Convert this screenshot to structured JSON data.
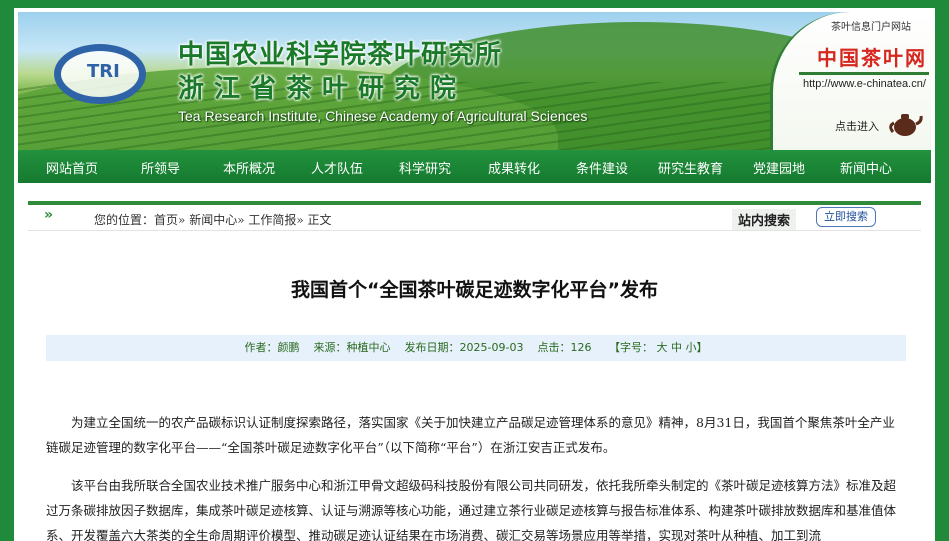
{
  "banner": {
    "logo_text": "TRI",
    "title_cn_1": "中国农业科学院茶叶研究所",
    "title_cn_2": "浙江省茶叶研究院",
    "title_en": "Tea Research Institute, Chinese Academy of Agricultural Sciences",
    "side_caption": "茶叶信息门户网站",
    "side_brand": "中国茶叶网",
    "side_url": "http://www.e-chinatea.cn/",
    "side_enter": "点击进入"
  },
  "nav": {
    "items": [
      "网站首页",
      "所领导",
      "本所概况",
      "人才队伍",
      "科学研究",
      "成果转化",
      "条件建设",
      "研究生教育",
      "党建园地",
      "新闻中心"
    ]
  },
  "breadcrumb": {
    "arrow": "»",
    "prefix": "您的位置：",
    "home": "首页",
    "sep": "» ",
    "level1": "新闻中心",
    "level2": "工作简报",
    "current": "正文"
  },
  "search": {
    "label": "站内搜索",
    "button": "立即搜索"
  },
  "article": {
    "title": "我国首个“全国茶叶碳足迹数字化平台”发布",
    "meta": {
      "author_label": "作者：",
      "author": "颜鹏",
      "source_label": "来源：",
      "source": "种植中心",
      "date_label": "发布日期：",
      "date": "2025-09-03",
      "hits_label": "点击：",
      "hits": "126",
      "font_label": "【字号：",
      "size_large": "大",
      "size_medium": "中",
      "size_small": "小",
      "font_close": "】"
    },
    "paragraphs": [
      "为建立全国统一的农产品碳标识认证制度探索路径，落实国家《关于加快建立产品碳足迹管理体系的意见》精神，8月31日，我国首个聚焦茶叶全产业链碳足迹管理的数字化平台——“全国茶叶碳足迹数字化平台”（以下简称“平台”）在浙江安吉正式发布。",
      "该平台由我所联合全国农业技术推广服务中心和浙江甲骨文超级码科技股份有限公司共同研发，依托我所牵头制定的《茶叶碳足迹核算方法》标准及超过万条碳排放因子数据库，集成茶叶碳足迹核算、认证与溯源等核心功能，通过建立茶行业碳足迹核算与报告标准体系、构建茶叶碳排放数据库和基准值体系、开发覆盖六大茶类的全生命周期评价模型、推动碳足迹认证结果在市场消费、碳汇交易等场景应用等举措，实现对茶叶从种植、加工到流"
    ]
  },
  "colors": {
    "frame_green": "#1f8a3a",
    "nav_green": "#157a2f",
    "meta_bg": "#e6f1fb",
    "brand_red": "#d7261e"
  }
}
